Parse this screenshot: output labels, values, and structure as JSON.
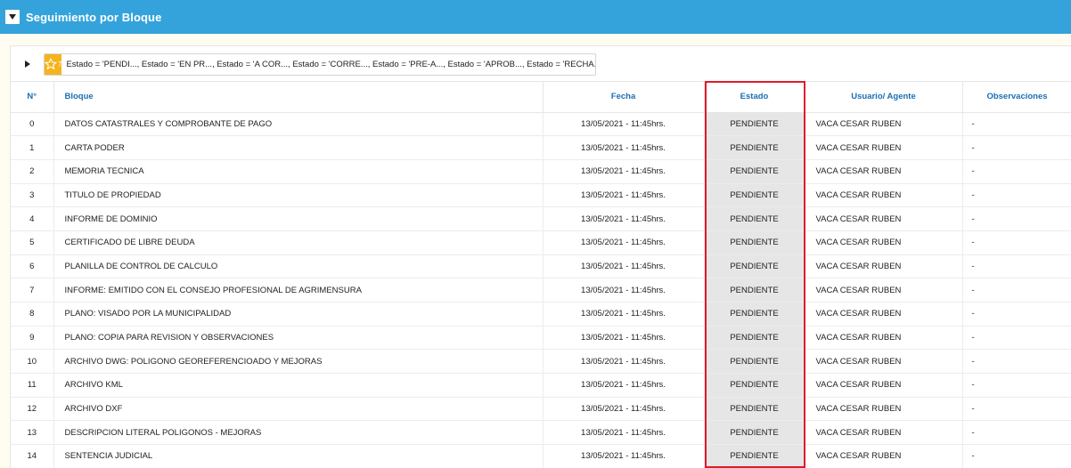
{
  "header": {
    "title": "Seguimiento por Bloque",
    "collapse_icon": "triangle-down-icon"
  },
  "filter": {
    "star_count": "7",
    "text": "Estado = 'PENDI..., Estado = 'EN PR..., Estado = 'A COR..., Estado = 'CORRE..., Estado = 'PRE-A..., Estado = 'APROB..., Estado = 'RECHA..."
  },
  "table": {
    "headers": {
      "num": "N°",
      "bloque": "Bloque",
      "fecha": "Fecha",
      "estado": "Estado",
      "usuario": "Usuario/ Agente",
      "observaciones": "Observaciones"
    },
    "rows": [
      {
        "num": "0",
        "bloque": "DATOS CATASTRALES Y COMPROBANTE DE PAGO",
        "fecha": "13/05/2021 - 11:45hrs.",
        "estado": "PENDIENTE",
        "usuario": "VACA CESAR RUBEN",
        "obs": "-"
      },
      {
        "num": "1",
        "bloque": "CARTA PODER",
        "fecha": "13/05/2021 - 11:45hrs.",
        "estado": "PENDIENTE",
        "usuario": "VACA CESAR RUBEN",
        "obs": "-"
      },
      {
        "num": "2",
        "bloque": "MEMORIA TECNICA",
        "fecha": "13/05/2021 - 11:45hrs.",
        "estado": "PENDIENTE",
        "usuario": "VACA CESAR RUBEN",
        "obs": "-"
      },
      {
        "num": "3",
        "bloque": "TITULO DE PROPIEDAD",
        "fecha": "13/05/2021 - 11:45hrs.",
        "estado": "PENDIENTE",
        "usuario": "VACA CESAR RUBEN",
        "obs": "-"
      },
      {
        "num": "4",
        "bloque": "INFORME DE DOMINIO",
        "fecha": "13/05/2021 - 11:45hrs.",
        "estado": "PENDIENTE",
        "usuario": "VACA CESAR RUBEN",
        "obs": "-"
      },
      {
        "num": "5",
        "bloque": "CERTIFICADO DE LIBRE DEUDA",
        "fecha": "13/05/2021 - 11:45hrs.",
        "estado": "PENDIENTE",
        "usuario": "VACA CESAR RUBEN",
        "obs": "-"
      },
      {
        "num": "6",
        "bloque": "PLANILLA DE CONTROL DE CALCULO",
        "fecha": "13/05/2021 - 11:45hrs.",
        "estado": "PENDIENTE",
        "usuario": "VACA CESAR RUBEN",
        "obs": "-"
      },
      {
        "num": "7",
        "bloque": "INFORME: EMITIDO CON EL CONSEJO PROFESIONAL DE AGRIMENSURA",
        "fecha": "13/05/2021 - 11:45hrs.",
        "estado": "PENDIENTE",
        "usuario": "VACA CESAR RUBEN",
        "obs": "-"
      },
      {
        "num": "8",
        "bloque": "PLANO: VISADO POR LA MUNICIPALIDAD",
        "fecha": "13/05/2021 - 11:45hrs.",
        "estado": "PENDIENTE",
        "usuario": "VACA CESAR RUBEN",
        "obs": "-"
      },
      {
        "num": "9",
        "bloque": "PLANO: COPIA PARA REVISION Y OBSERVACIONES",
        "fecha": "13/05/2021 - 11:45hrs.",
        "estado": "PENDIENTE",
        "usuario": "VACA CESAR RUBEN",
        "obs": "-"
      },
      {
        "num": "10",
        "bloque": "ARCHIVO DWG: POLIGONO GEOREFERENCIOADO Y MEJORAS",
        "fecha": "13/05/2021 - 11:45hrs.",
        "estado": "PENDIENTE",
        "usuario": "VACA CESAR RUBEN",
        "obs": "-"
      },
      {
        "num": "11",
        "bloque": "ARCHIVO KML",
        "fecha": "13/05/2021 - 11:45hrs.",
        "estado": "PENDIENTE",
        "usuario": "VACA CESAR RUBEN",
        "obs": "-"
      },
      {
        "num": "12",
        "bloque": "ARCHIVO DXF",
        "fecha": "13/05/2021 - 11:45hrs.",
        "estado": "PENDIENTE",
        "usuario": "VACA CESAR RUBEN",
        "obs": "-"
      },
      {
        "num": "13",
        "bloque": "DESCRIPCION LITERAL POLIGONOS - MEJORAS",
        "fecha": "13/05/2021 - 11:45hrs.",
        "estado": "PENDIENTE",
        "usuario": "VACA CESAR RUBEN",
        "obs": "-"
      },
      {
        "num": "14",
        "bloque": "SENTENCIA JUDICIAL",
        "fecha": "13/05/2021 - 11:45hrs.",
        "estado": "PENDIENTE",
        "usuario": "VACA CESAR RUBEN",
        "obs": "-"
      }
    ]
  },
  "colors": {
    "header_bg": "#34a3db",
    "header_link": "#1a6fb5",
    "star": "#f5b31c",
    "highlight": "#e01a2c",
    "estado_bg": "#e6e6e6"
  }
}
